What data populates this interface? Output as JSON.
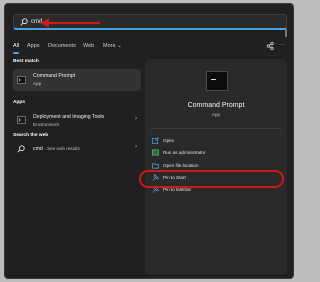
{
  "search": {
    "value": "cmd"
  },
  "tabs": [
    {
      "label": "All",
      "active": true
    },
    {
      "label": "Apps"
    },
    {
      "label": "Documents"
    },
    {
      "label": "Web"
    },
    {
      "label": "More"
    }
  ],
  "tabbar_icons": [
    "share-icon",
    "more-icon"
  ],
  "left": {
    "best_match_heading": "Best match",
    "best_match": {
      "title": "Command Prompt",
      "subtitle": "App"
    },
    "apps_heading": "Apps",
    "apps": [
      {
        "title": "Deployment and Imaging Tools",
        "subtitle": "Environment"
      }
    ],
    "web_heading": "Search the web",
    "web": [
      {
        "title": "cmd",
        "subtitle": "- See web results"
      }
    ]
  },
  "detail": {
    "title": "Command Prompt",
    "type": "App",
    "actions": [
      {
        "label": "Open",
        "icon": "open-icon"
      },
      {
        "label": "Run as administrator",
        "icon": "shield-icon"
      },
      {
        "label": "Open file location",
        "icon": "folder-icon"
      },
      {
        "label": "Pin to Start",
        "icon": "pin-icon"
      },
      {
        "label": "Pin to taskbar",
        "icon": "pin-icon"
      }
    ]
  },
  "colors": {
    "accent": "#4ca0e0",
    "annotation": "#d11616",
    "panel": "#202020"
  }
}
